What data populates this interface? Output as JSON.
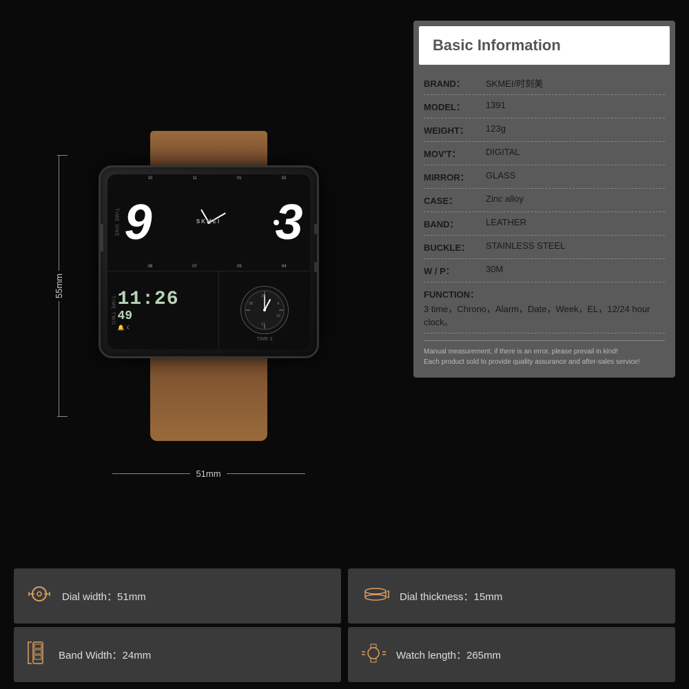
{
  "page": {
    "bg_color": "#0a0a0a"
  },
  "info_panel": {
    "header": "Basic Information",
    "rows": [
      {
        "label": "BRAND：",
        "value": "SKMEI/时刻美"
      },
      {
        "label": "MODEL：",
        "value": "1391"
      },
      {
        "label": "WEIGHT：",
        "value": "123g"
      },
      {
        "label": "MOV'T：",
        "value": "DIGITAL"
      },
      {
        "label": "MIRROR：",
        "value": "GLASS"
      },
      {
        "label": "CASE：",
        "value": "Zinc alloy"
      },
      {
        "label": "BAND：",
        "value": "LEATHER"
      },
      {
        "label": "BUCKLE：",
        "value": "STAINLESS STEEL"
      },
      {
        "label": "W / P：",
        "value": "30M"
      }
    ],
    "function_label": "FUNCTION：",
    "function_value": "3 time，Chrono，Alarm，Date，Week，EL，12/24 hour clock。",
    "disclaimer_line1": "Manual measurement, if there is an error, please prevail in kind!",
    "disclaimer_line2": "Each product sold to provide quality assurance and after-sales service!"
  },
  "watch": {
    "digit_left": "9",
    "digit_right": "3",
    "brand": "SKMEI",
    "digital_time": "11:26",
    "digital_seconds": "49",
    "time_one_label": "TIME ONE",
    "time_two_label": "TIME TWO",
    "time_three_label": "TIME 3",
    "tick_numbers": [
      "10",
      "11",
      "01",
      "02"
    ],
    "sub_numbers": [
      "08",
      "07",
      "05",
      "04"
    ]
  },
  "dimensions": {
    "height_label": "55mm",
    "width_label": "51mm"
  },
  "stats": [
    {
      "icon": "⊙",
      "label": "Dial width：51mm",
      "icon_name": "dial-width-icon"
    },
    {
      "icon": "⌒",
      "label": "Dial thickness：15mm",
      "icon_name": "dial-thickness-icon"
    },
    {
      "icon": "▯",
      "label": "Band Width：24mm",
      "icon_name": "band-width-icon"
    },
    {
      "icon": "⊙",
      "label": "Watch length：265mm",
      "icon_name": "watch-length-icon"
    }
  ]
}
